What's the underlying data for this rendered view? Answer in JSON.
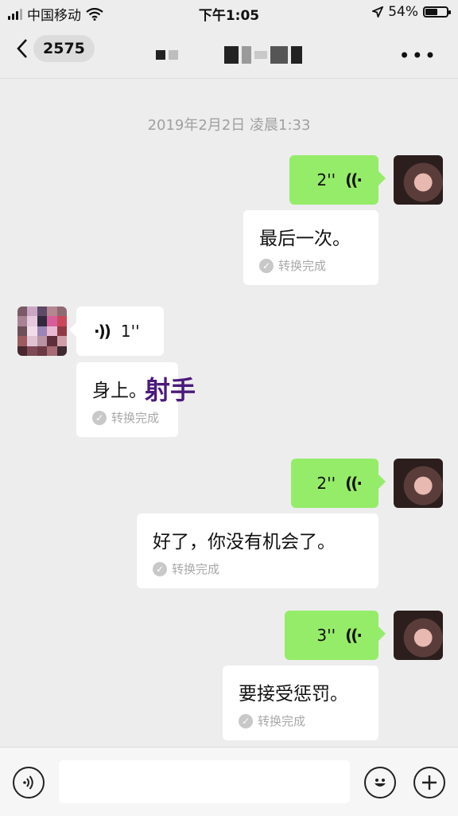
{
  "status_bar": {
    "carrier": "中国移动",
    "time": "下午1:05",
    "battery_percent": "54%",
    "battery_level": 0.54
  },
  "nav": {
    "back_badge": "2575",
    "more_label": "•••"
  },
  "chat": {
    "timestamp": "2019年2月2日 凌晨1:33",
    "messages": [
      {
        "direction": "outgoing",
        "duration": "2''",
        "transcript": "最后一次。",
        "status": "转换完成"
      },
      {
        "direction": "incoming",
        "duration": "1''",
        "transcript": "身上。",
        "status": "转换完成",
        "overlay_text": "射手"
      },
      {
        "direction": "outgoing",
        "duration": "2''",
        "transcript": "好了，你没有机会了。",
        "status": "转换完成"
      },
      {
        "direction": "outgoing",
        "duration": "3''",
        "transcript": "要接受惩罚。",
        "status": "转换完成"
      }
    ]
  },
  "icons": {
    "wave_out": "((·",
    "wave_in": "·))",
    "check": "✓",
    "back": "‹"
  },
  "colors": {
    "outgoing_bubble": "#95ec69",
    "incoming_bubble": "#ffffff",
    "background": "#ededed",
    "overlay_text": "#4b1a7a"
  }
}
